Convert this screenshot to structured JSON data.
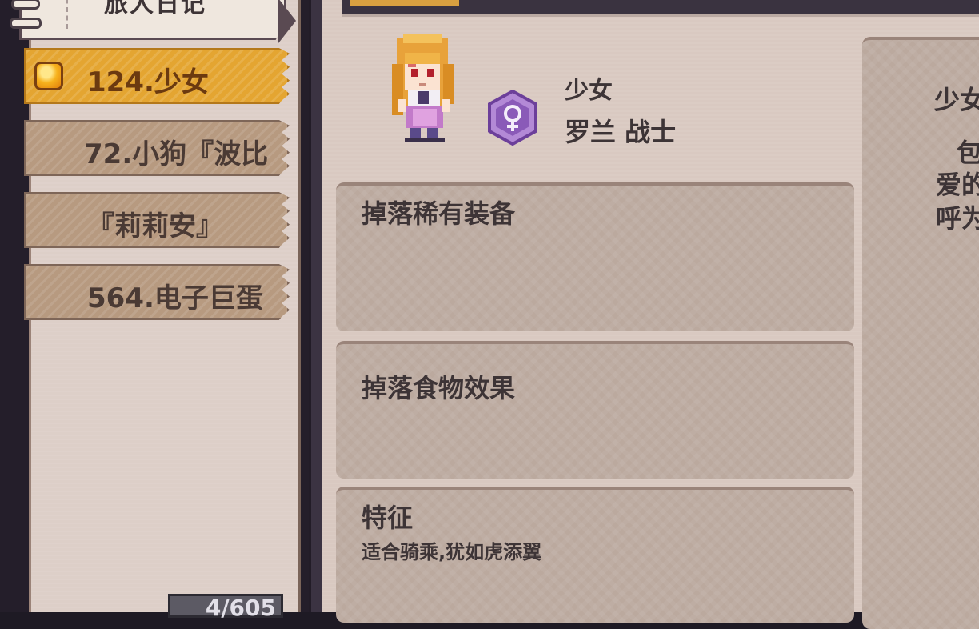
{
  "sidebar": {
    "title": "旅人日记",
    "entries": [
      {
        "label": "124.少女",
        "selected": true,
        "icon": "gem-icon"
      },
      {
        "label": "72.小狗『波比",
        "selected": false
      },
      {
        "label": "『莉莉安』",
        "selected": false
      },
      {
        "label": "564.电子巨蛋",
        "selected": false
      }
    ],
    "page_counter": "4/605"
  },
  "character": {
    "name": "少女",
    "class": "罗兰 战士",
    "gender_symbol": "♀",
    "badge_color": "#8a5ab8"
  },
  "sections": {
    "rare_equipment": {
      "title": "掉落稀有装备"
    },
    "food_effect": {
      "title": "掉落食物效果"
    },
    "traits": {
      "title": "特征",
      "text": "适合骑乘,犹如虎添翼"
    }
  },
  "right_card": {
    "title": "少女",
    "lines": [
      "包",
      "爱的",
      "呼为"
    ]
  },
  "colors": {
    "selected_entry": "#e4a531",
    "entry": "#b79a80",
    "panel": "#d9c9c1",
    "box": "#bba99e"
  }
}
